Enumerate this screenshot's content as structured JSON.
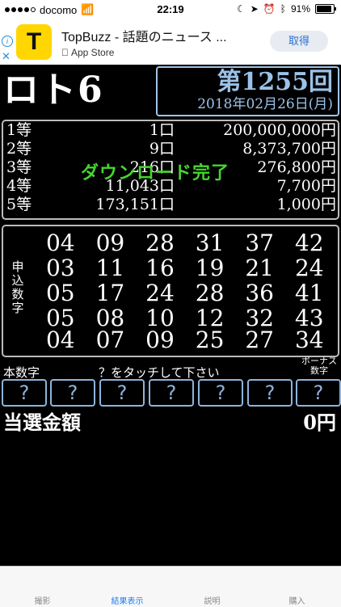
{
  "status": {
    "carrier": "docomo",
    "time": "22:19",
    "battery": "91%",
    "battery_level": 0.91
  },
  "ad": {
    "logo_letter": "T",
    "title": "TopBuzz - 話題のニュース ...",
    "store": "App Store",
    "button": "取得",
    "info_icon": "info-icon",
    "close_icon": "close-icon"
  },
  "header": {
    "app_title": "ロト6",
    "draw_number": "第1255回",
    "draw_date": "2018年02月26日(月)"
  },
  "prizes": [
    {
      "rank": "1等",
      "count": "1口",
      "amount": "200,000,000円"
    },
    {
      "rank": "2等",
      "count": "9口",
      "amount": "8,373,700円"
    },
    {
      "rank": "3等",
      "count": "216口",
      "amount": "276,800円"
    },
    {
      "rank": "4等",
      "count": "11,043口",
      "amount": "7,700円"
    },
    {
      "rank": "5等",
      "count": "173,151口",
      "amount": "1,000円"
    }
  ],
  "overlay_message": "ダウンロード完了",
  "entries": {
    "side_label": "申込数字",
    "rows": [
      [
        "04",
        "09",
        "28",
        "31",
        "37",
        "42"
      ],
      [
        "03",
        "11",
        "16",
        "19",
        "21",
        "24"
      ],
      [
        "05",
        "17",
        "24",
        "28",
        "36",
        "41"
      ],
      [
        "05",
        "08",
        "10",
        "12",
        "32",
        "43"
      ],
      [
        "04",
        "07",
        "09",
        "25",
        "27",
        "34"
      ]
    ]
  },
  "main_numbers_label": "本数字",
  "touch_hint": "？をタッチして下さい",
  "bonus_label": "ボーナス数字",
  "question_buttons": [
    "?",
    "?",
    "?",
    "?",
    "?",
    "?",
    "?"
  ],
  "win": {
    "label": "当選金額",
    "amount": "0円"
  },
  "tabs": [
    "撮影",
    "結果表示",
    "説明",
    "購入"
  ]
}
